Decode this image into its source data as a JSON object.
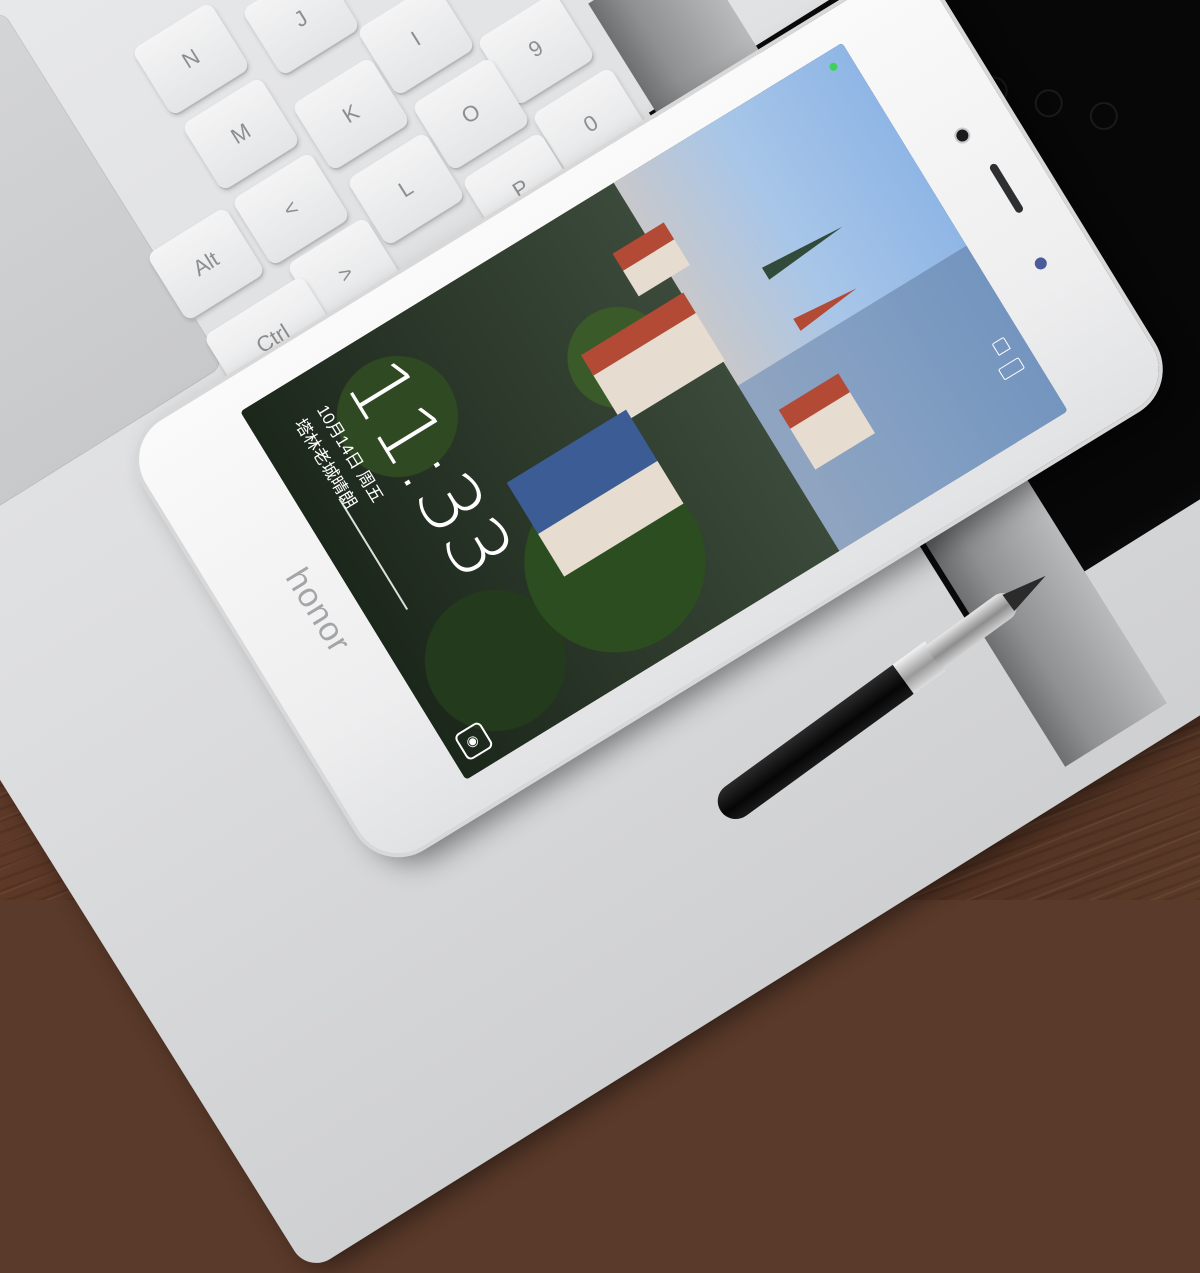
{
  "scene": {
    "keyboard_keys": [
      {
        "label": "N"
      },
      {
        "label": "J"
      },
      {
        "label": "I"
      },
      {
        "label": "9"
      },
      {
        "label": "M"
      },
      {
        "label": "K"
      },
      {
        "label": "O"
      },
      {
        "label": "0"
      },
      {
        "label": "<"
      },
      {
        "label": "L"
      },
      {
        "label": "P"
      },
      {
        "label": "Alt"
      },
      {
        "label": ">"
      },
      {
        "label": "Ctrl"
      }
    ]
  },
  "phone": {
    "brand": "honor",
    "lock_screen": {
      "time": "11:33",
      "date": "10月14日 周五",
      "caption": "塔林老城晴朗"
    },
    "colors": {
      "body": "#f2f2f3",
      "screen_sky": "#9fbbe2"
    }
  }
}
